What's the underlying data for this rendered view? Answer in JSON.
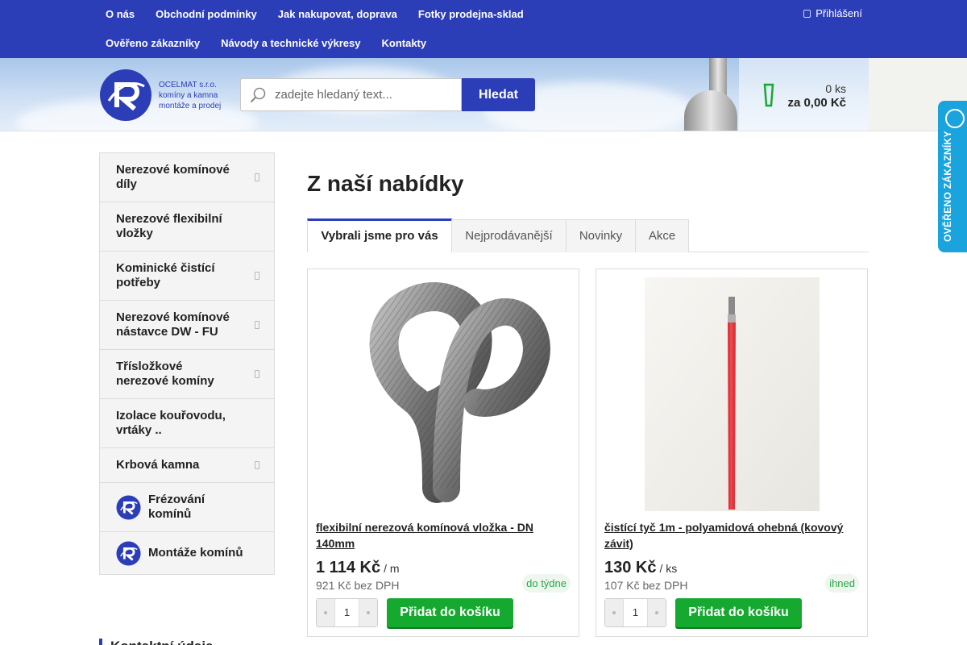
{
  "nav": {
    "row1": [
      "O nás",
      "Obchodní podmínky",
      "Jak nakupovat, doprava",
      "Fotky prodejna-sklad"
    ],
    "row2": [
      "Ověřeno zákazníky",
      "Návody a technické výkresy",
      "Kontakty"
    ],
    "login": "Přihlášení"
  },
  "logo": {
    "line1": "OCELMAT s.r.o.",
    "line2": "komíny a kamna",
    "line3": "montáže a prodej",
    "icon": "ocelmat-logo-icon"
  },
  "search": {
    "placeholder": "zadejte hledaný text...",
    "button": "Hledat",
    "icon": "search-icon"
  },
  "cart": {
    "qty": "0 ks",
    "total": "za 0,00 Kč",
    "icon": "cart-icon"
  },
  "overeno_widget": {
    "label": "OVĚŘENO ZÁKAZNÍKY"
  },
  "sidebar": {
    "items": [
      {
        "label": "Nerezové komínové díly",
        "submenu": true
      },
      {
        "label": "Nerezové flexibilní vložky",
        "submenu": false
      },
      {
        "label": "Kominické čistící potřeby",
        "submenu": true
      },
      {
        "label": "Nerezové komínové nástavce DW - FU",
        "submenu": true
      },
      {
        "label": "Třísložkové nerezové komíny",
        "submenu": true
      },
      {
        "label": "Izolace kouřovodu, vrtáky ..",
        "submenu": false
      },
      {
        "label": "Krbová kamna",
        "submenu": true
      },
      {
        "label": "Frézování komínů",
        "submenu": false,
        "icon": "ocelmat-logo-icon"
      },
      {
        "label": "Montáže komínů",
        "submenu": false,
        "icon": "ocelmat-logo-icon"
      }
    ],
    "next_heading": "Kontaktní údaje"
  },
  "main": {
    "title": "Z naší nabídky",
    "tabs": [
      {
        "label": "Vybrali jsme pro vás",
        "active": true
      },
      {
        "label": "Nejprodávanější",
        "active": false
      },
      {
        "label": "Novinky",
        "active": false
      },
      {
        "label": "Akce",
        "active": false
      }
    ]
  },
  "products": [
    {
      "name": "flexibilní nerezová komínová vložka - DN 140mm",
      "price": "1 114 Kč",
      "unit": "/ m",
      "net": "921 Kč bez DPH",
      "availability": "do týdne",
      "qty": "1",
      "add_label": "Přidat do košíku",
      "image": "flexible-steel-liner-image"
    },
    {
      "name": "čistící tyč 1m - polyamidová ohebná (kovový závit)",
      "price": "130 Kč",
      "unit": "/ ks",
      "net": "107 Kč bez DPH",
      "availability": "ihned",
      "qty": "1",
      "add_label": "Přidat do košíku",
      "image": "cleaning-rod-image"
    }
  ],
  "colors": {
    "brand": "#2c3db8",
    "add_button": "#15a92f",
    "availability": "#2ba44a",
    "overeno": "#1aa3dc"
  }
}
